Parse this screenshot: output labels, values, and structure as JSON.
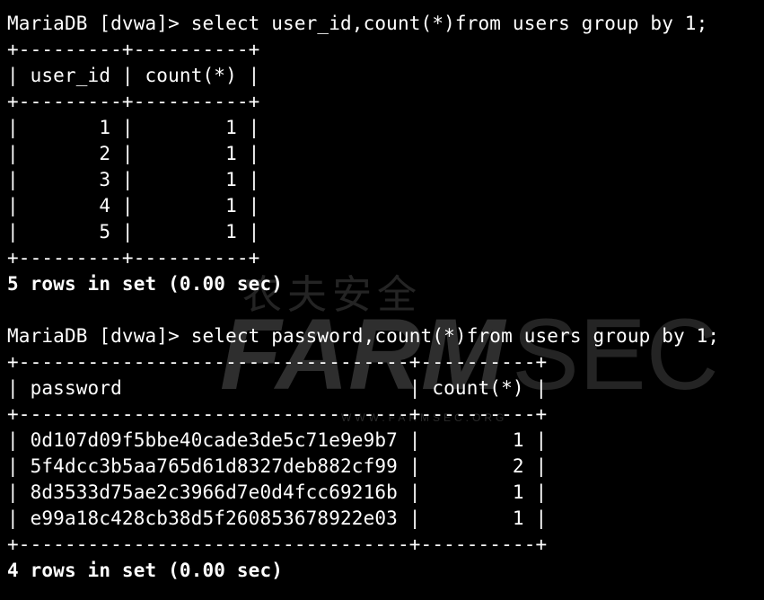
{
  "query1": {
    "prompt": "MariaDB [dvwa]> select user_id,count(*)from users group by 1;",
    "border": "+---------+----------+",
    "header": "| user_id | count(*) |",
    "rows": [
      "|       1 |        1 |",
      "|       2 |        1 |",
      "|       3 |        1 |",
      "|       4 |        1 |",
      "|       5 |        1 |"
    ],
    "result": "5 rows in set (0.00 sec)"
  },
  "query2": {
    "prompt": "MariaDB [dvwa]> select password,count(*)from users group by 1;",
    "border": "+----------------------------------+----------+",
    "header": "| password                         | count(*) |",
    "rows": [
      "| 0d107d09f5bbe40cade3de5c71e9e9b7 |        1 |",
      "| 5f4dcc3b5aa765d61d8327deb882cf99 |        2 |",
      "| 8d3533d75ae2c3966d7e0d4fcc69216b |        1 |",
      "| e99a18c428cb38d5f260853678922e03 |        1 |"
    ],
    "result": "4 rows in set (0.00 sec)"
  },
  "watermark": {
    "chinese": "农夫安全",
    "brand_bold": "FARM",
    "brand_light": "SEC",
    "url": "WWW.FARMSEC.ORG"
  }
}
